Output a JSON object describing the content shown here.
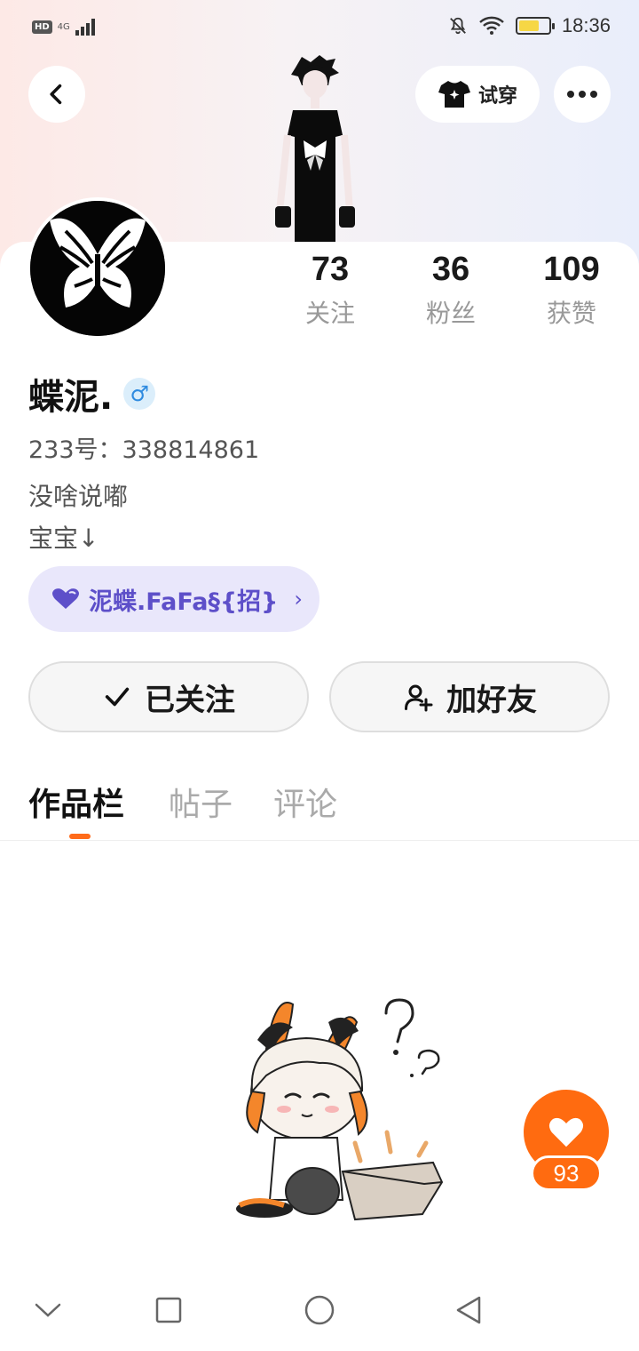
{
  "status_bar": {
    "hd": "HD",
    "network": "4G",
    "time": "18:36",
    "battery_level": 0.7
  },
  "header": {
    "tryon_label": "试穿"
  },
  "profile": {
    "stats": [
      {
        "value": "73",
        "label": "关注"
      },
      {
        "value": "36",
        "label": "粉丝"
      },
      {
        "value": "109",
        "label": "获赞"
      }
    ],
    "username": "蝶泥.",
    "gender_symbol": "♂",
    "uid": "233号：338814861",
    "bio_lines": [
      "没啥说嘟",
      "宝宝↓"
    ],
    "guild_name": "泥蝶.FaFa§{招}",
    "guild_chevron": "›"
  },
  "actions": {
    "follow_label": "已关注",
    "add_friend_label": "加好友"
  },
  "tabs": [
    {
      "label": "作品栏",
      "active": true
    },
    {
      "label": "帖子",
      "active": false
    },
    {
      "label": "评论",
      "active": false
    }
  ],
  "like": {
    "count": "93"
  },
  "colors": {
    "accent": "#ff6b10",
    "guild_bg": "#e9e7fb",
    "guild_text": "#5d4fc9",
    "gender_blue": "#2f8be0"
  },
  "icons": {
    "back": "chevron-left-icon",
    "tryon": "tshirt-icon",
    "more": "more-dots-icon",
    "check": "check-icon",
    "add_friend": "add-user-icon",
    "like": "heart-icon",
    "guild": "heart-icon"
  }
}
